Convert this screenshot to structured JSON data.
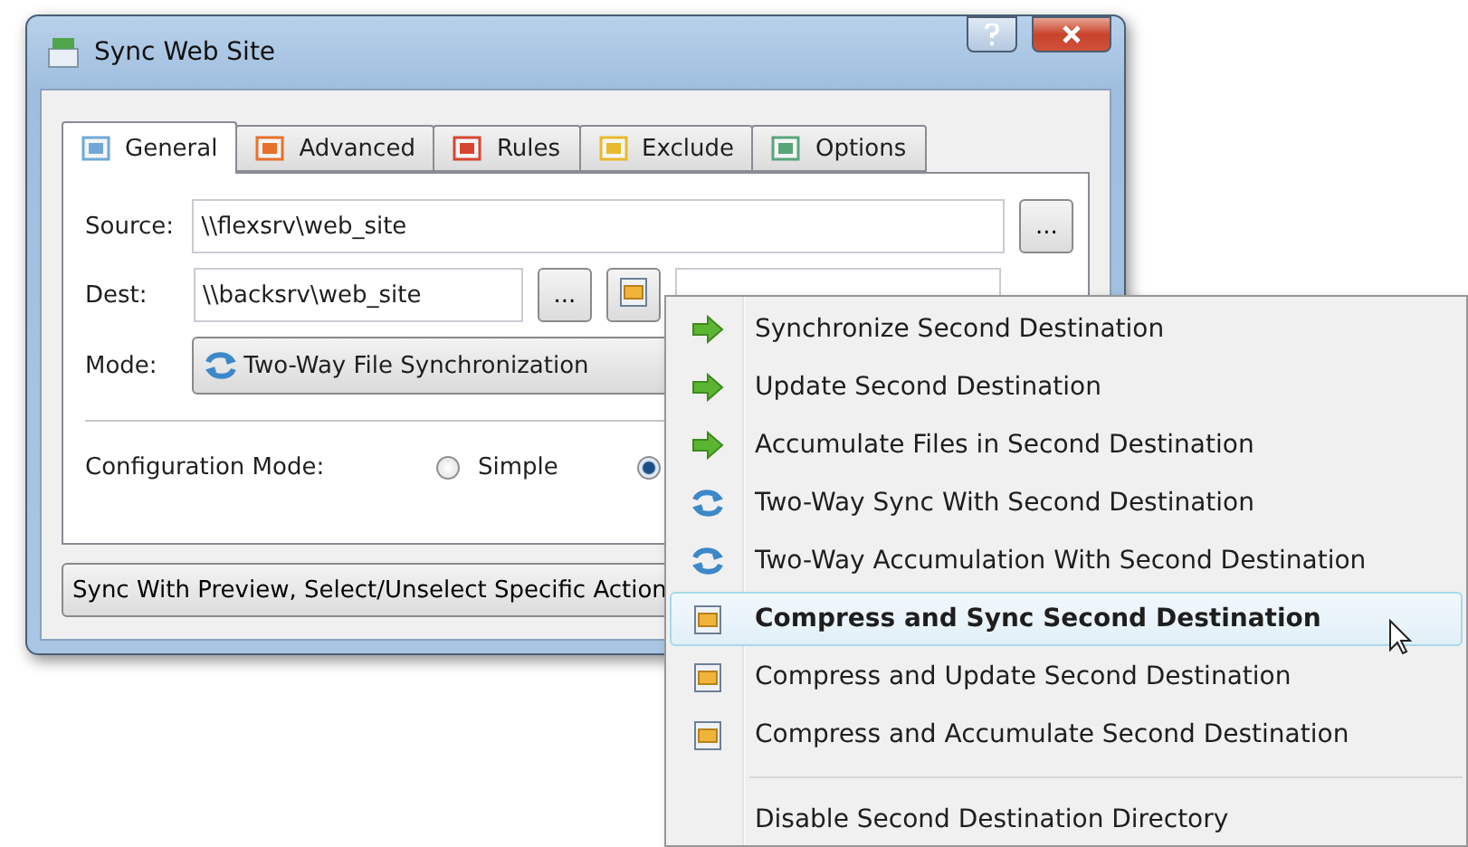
{
  "window": {
    "title": "Sync Web Site"
  },
  "tabs": [
    {
      "label": "General",
      "selected": true
    },
    {
      "label": "Advanced",
      "selected": false
    },
    {
      "label": "Rules",
      "selected": false
    },
    {
      "label": "Exclude",
      "selected": false
    },
    {
      "label": "Options",
      "selected": false
    }
  ],
  "source": {
    "label": "Source:",
    "value": "\\\\flexsrv\\web_site",
    "browse": "..."
  },
  "dest": {
    "label": "Dest:",
    "value": "\\\\backsrv\\web_site",
    "browse": "..."
  },
  "mode": {
    "label": "Mode:",
    "value": "Two-Way File Synchronization"
  },
  "configuration": {
    "label": "Configuration Mode:",
    "options": [
      {
        "label": "Simple",
        "selected": false
      },
      {
        "selected": true
      }
    ]
  },
  "bottom_button": "Sync With Preview, Select/Unselect Specific Action",
  "menu": {
    "items": [
      {
        "kind": "arrow",
        "label": "Synchronize Second Destination",
        "selected": false
      },
      {
        "kind": "arrow",
        "label": "Update Second Destination",
        "selected": false
      },
      {
        "kind": "arrow",
        "label": "Accumulate Files in Second Destination",
        "selected": false
      },
      {
        "kind": "twoway",
        "label": "Two-Way Sync With Second Destination",
        "selected": false
      },
      {
        "kind": "twoway",
        "label": "Two-Way Accumulation With Second Destination",
        "selected": false
      },
      {
        "kind": "compress",
        "label": "Compress and Sync Second Destination",
        "selected": true
      },
      {
        "kind": "compress",
        "label": "Compress and Update Second Destination",
        "selected": false
      },
      {
        "kind": "compress",
        "label": "Compress and Accumulate Second Destination",
        "selected": false
      },
      {
        "kind": "separator"
      },
      {
        "kind": "plain",
        "label": "Disable Second Destination Directory",
        "selected": false
      }
    ]
  }
}
